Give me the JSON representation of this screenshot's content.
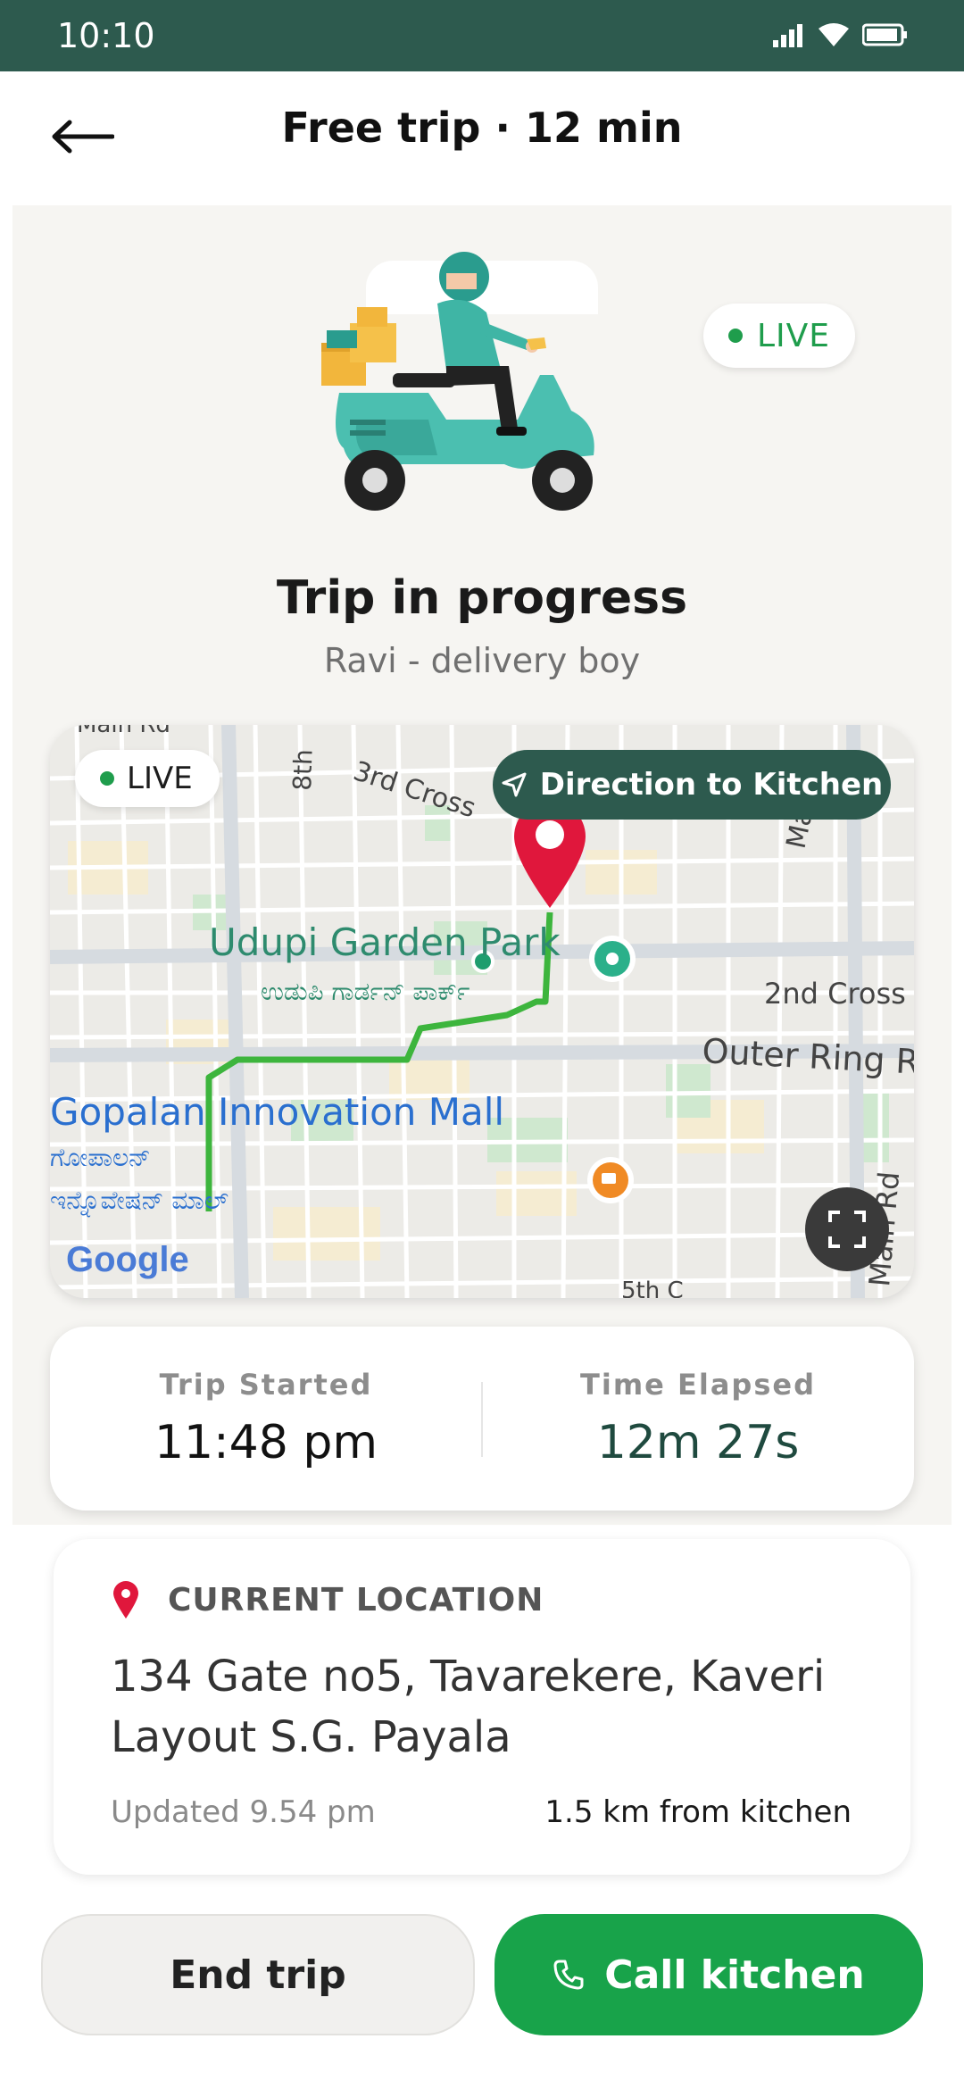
{
  "status_bar": {
    "time": "10:10"
  },
  "header": {
    "title": "Free trip · 12 min",
    "back_icon": "arrow-left-icon"
  },
  "hero": {
    "live_label": "LIVE",
    "title": "Trip in progress",
    "subtitle": "Ravi - delivery boy",
    "illustration": "scooter-delivery-rider"
  },
  "map": {
    "live_label": "LIVE",
    "direction_button": "Direction to Kitchen",
    "labels": {
      "park": "Udupi Garden Park",
      "park_kn": "ಉಡುಪಿ ಗಾರ್ಡನ್ ಪಾರ್ಕ್",
      "mall": "Gopalan Innovation Mall",
      "mall_kn_1": "ಗೋಪಾಲನ್",
      "mall_kn_2": "ಇನ್ನೊವೇಷನ್ ಮಾಲ್",
      "road_3rd_cross": "3rd Cross",
      "road_8th": "8th",
      "road_2nd_cross": "2nd Cross",
      "road_outer_ring": "Outer Ring R",
      "road_main_rd": "Main Rd",
      "road_maru": "Maru",
      "road_top": "Main Rd",
      "road_5th": "5th C",
      "logo": "Google"
    },
    "route_color": "#3db53d",
    "pin_color": "#e0173c"
  },
  "trip_times": {
    "started_label": "Trip Started",
    "started_value": "11:48 pm",
    "elapsed_label": "Time Elapsed",
    "elapsed_value": "12m 27s"
  },
  "location": {
    "label": "CURRENT LOCATION",
    "address": "134 Gate no5, Tavarekere, Kaveri Layout S.G. Payala",
    "updated": "Updated 9.54 pm",
    "distance": "1.5 km from kitchen"
  },
  "actions": {
    "end_trip": "End trip",
    "call_kitchen": "Call kitchen"
  },
  "colors": {
    "primary_dark": "#2d5a4e",
    "accent_green": "#18a34a",
    "live_green": "#1f9d4c"
  }
}
